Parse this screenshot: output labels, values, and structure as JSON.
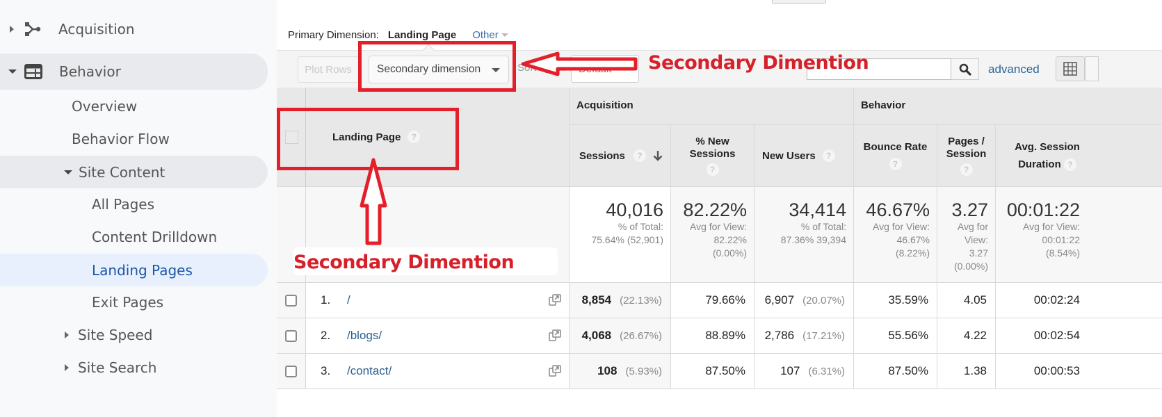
{
  "sidebar": {
    "items": [
      {
        "label": "Acquisition",
        "icon": "acquisition-icon",
        "state": "collapsed"
      },
      {
        "label": "Behavior",
        "icon": "behavior-icon",
        "state": "expanded"
      },
      {
        "label": "Overview"
      },
      {
        "label": "Behavior Flow"
      },
      {
        "label": "Site Content",
        "state": "expanded"
      },
      {
        "label": "All Pages"
      },
      {
        "label": "Content Drilldown"
      },
      {
        "label": "Landing Pages",
        "active": true
      },
      {
        "label": "Exit Pages"
      },
      {
        "label": "Site Speed",
        "state": "collapsed"
      },
      {
        "label": "Site Search",
        "state": "collapsed"
      }
    ]
  },
  "dimension_bar": {
    "label": "Primary Dimension:",
    "value": "Landing Page",
    "other": "Other"
  },
  "toolbar": {
    "plot_rows": "Plot Rows",
    "secondary_dimension": "Secondary dimension",
    "sort_type_label": "Sort Type:",
    "sort_type_value": "Default",
    "search_placeholder": "",
    "advanced": "advanced"
  },
  "table": {
    "dimension_header": "Landing Page",
    "groups": {
      "acquisition": "Acquisition",
      "behavior": "Behavior"
    },
    "columns": {
      "sessions": "Sessions",
      "pct_new_sessions": "% New Sessions",
      "new_users": "New Users",
      "bounce_rate": "Bounce Rate",
      "pages_session": "Pages / Session",
      "avg_session_duration": "Avg. Session Duration"
    },
    "totals": {
      "sessions": {
        "value": "40,016",
        "line1": "% of Total:",
        "line2": "75.64% (52,901)"
      },
      "pct_new_sessions": {
        "value": "82.22%",
        "line1": "Avg for View:",
        "line2": "82.22%",
        "line3": "(0.00%)"
      },
      "new_users": {
        "value": "34,414",
        "line1": "% of Total:",
        "line2": "87.36% 39,394"
      },
      "bounce_rate": {
        "value": "46.67%",
        "line1": "Avg for View:",
        "line2": "46.67%",
        "line3": "(8.22%)"
      },
      "pages_session": {
        "value": "3.27",
        "line1": "Avg for",
        "line2": "View:",
        "line3": "3.27",
        "line4": "(0.00%)"
      },
      "avg_session_duration": {
        "value": "00:01:22",
        "line1": "Avg for View:",
        "line2": "00:01:22",
        "line3": "(8.54%)"
      }
    },
    "rows": [
      {
        "index": "1.",
        "page": "/",
        "sessions": "8,854",
        "sessions_pct": "(22.13%)",
        "pct_new_sessions": "79.66%",
        "new_users": "6,907",
        "new_users_pct": "(20.07%)",
        "bounce_rate": "35.59%",
        "pages_session": "4.05",
        "avg_session_duration": "00:02:24"
      },
      {
        "index": "2.",
        "page": "/blogs/",
        "sessions": "4,068",
        "sessions_pct": "(26.67%)",
        "pct_new_sessions": "88.89%",
        "new_users": "2,786",
        "new_users_pct": "(17.21%)",
        "bounce_rate": "55.56%",
        "pages_session": "4.22",
        "avg_session_duration": "00:02:54"
      },
      {
        "index": "3.",
        "page": "/contact/",
        "sessions": "108",
        "sessions_pct": "(5.93%)",
        "pct_new_sessions": "87.50%",
        "new_users": "107",
        "new_users_pct": "(6.31%)",
        "bounce_rate": "87.50%",
        "pages_session": "1.38",
        "avg_session_duration": "00:00:53"
      }
    ]
  },
  "annotations": {
    "label_top": "Secondary Dimention",
    "label_bottom": "Secondary Dimention",
    "color": "#e3202a"
  }
}
